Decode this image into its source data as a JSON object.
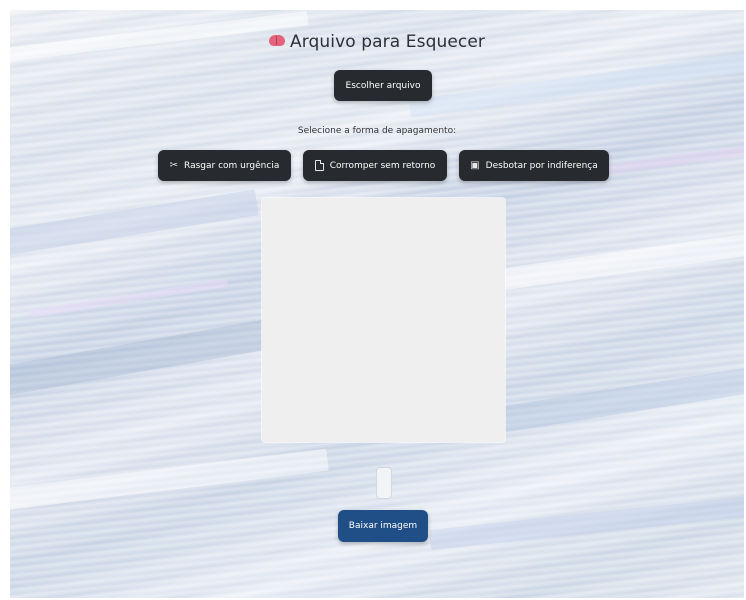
{
  "app": {
    "title": "Arquivo para Esquecer",
    "title_icon": "brain-icon"
  },
  "file_picker": {
    "label": "Escolher arquivo"
  },
  "erase_options": {
    "prompt": "Selecione a forma de apagamento:",
    "options": [
      {
        "label": "Rasgar com urgência",
        "icon": "tear-icon"
      },
      {
        "label": "Corromper sem retorno",
        "icon": "document-icon"
      },
      {
        "label": "Desbotar por indiferença",
        "icon": "faded-photo-icon"
      }
    ]
  },
  "download": {
    "label": "Baixar imagem"
  },
  "colors": {
    "dark_button": "#272a2e",
    "primary_button": "#1f4f86",
    "canvas": "#efefef",
    "brain": "#e2637b"
  }
}
